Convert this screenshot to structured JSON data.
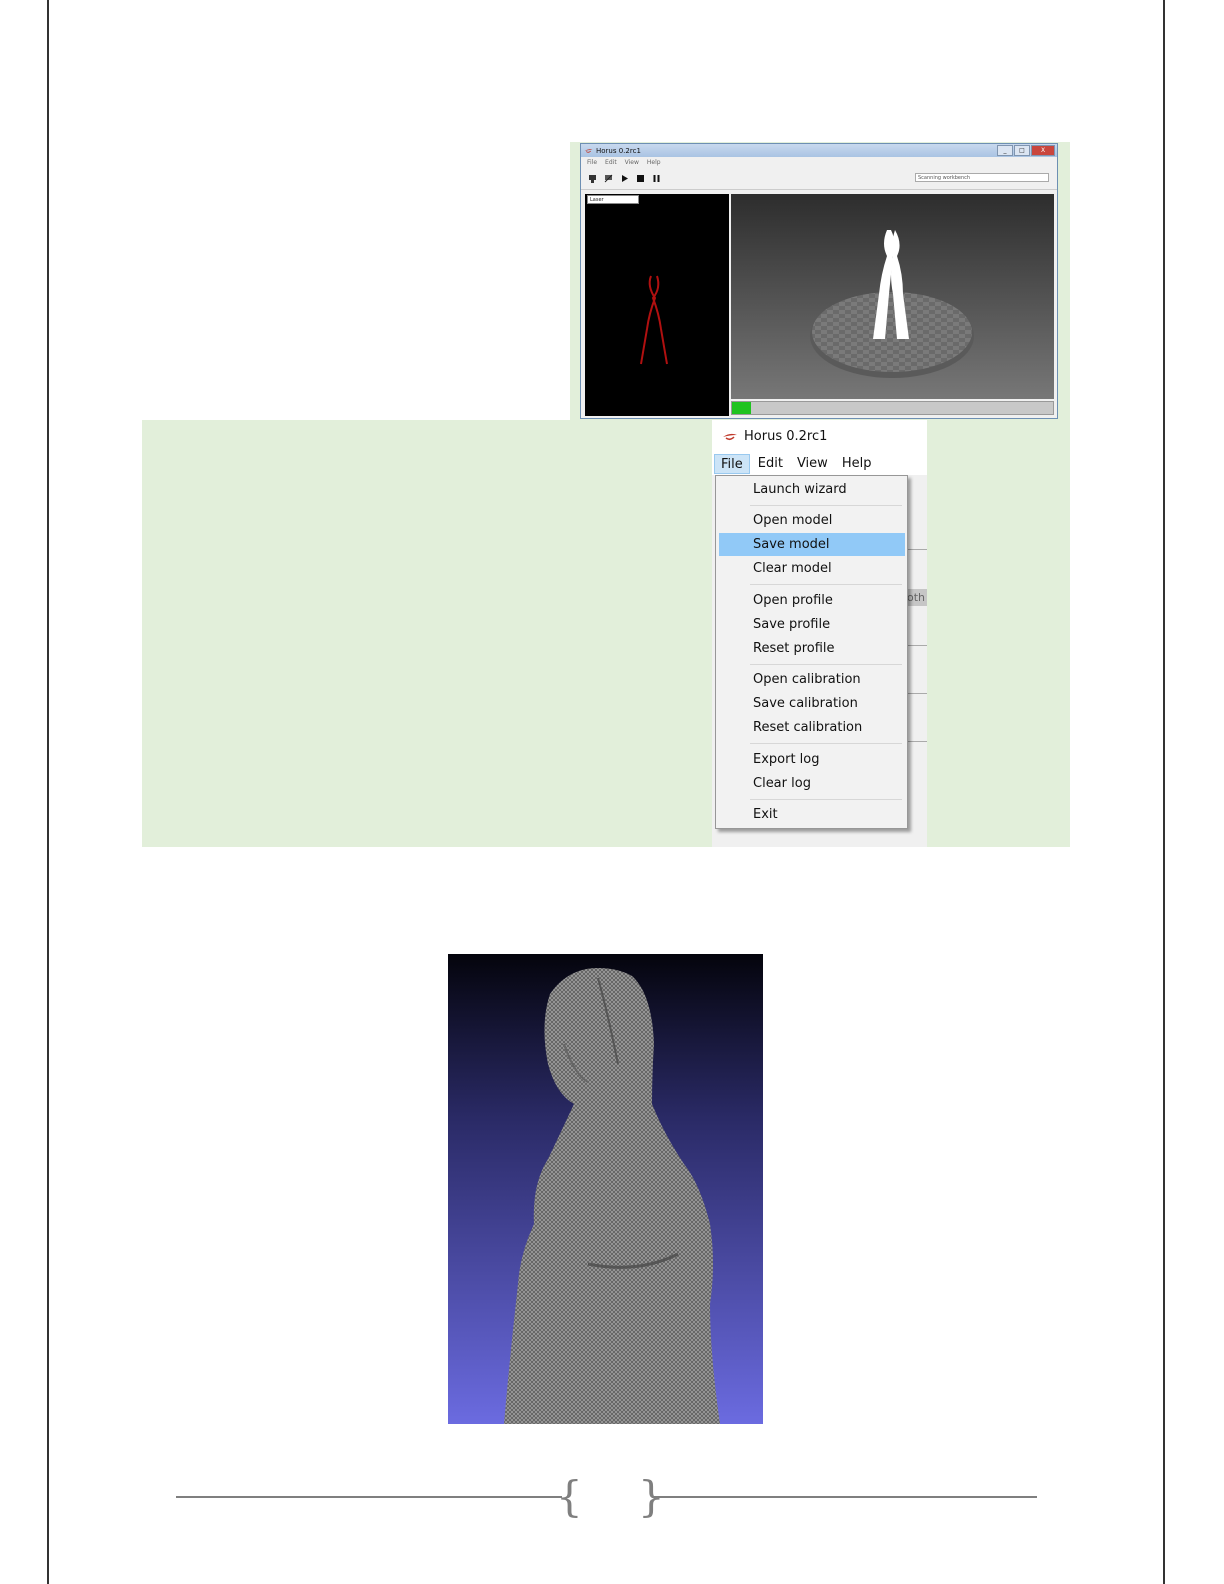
{
  "small_window": {
    "title": "Horus 0.2rc1",
    "menu": [
      "File",
      "Edit",
      "View",
      "Help"
    ],
    "toolbar_icons": [
      "connect-icon",
      "disconnect-icon",
      "play-icon",
      "stop-icon",
      "pause-icon"
    ],
    "workbench_select": "Scanning workbench",
    "camera_mode_select": "Laser",
    "controls": [
      "_",
      "□",
      "X"
    ]
  },
  "menu_window": {
    "title": "Horus 0.2rc1",
    "menubar": [
      "File",
      "Edit",
      "View",
      "Help"
    ],
    "active_menu": "File",
    "partial_text_behind": "oth",
    "file_menu": [
      {
        "label": "Launch wizard"
      },
      {
        "label": "Open model"
      },
      {
        "label": "Save model",
        "highlighted": true
      },
      {
        "label": "Clear model"
      },
      {
        "label": "Open profile"
      },
      {
        "label": "Save profile"
      },
      {
        "label": "Reset profile"
      },
      {
        "label": "Open calibration"
      },
      {
        "label": "Save calibration"
      },
      {
        "label": "Reset calibration"
      },
      {
        "label": "Export log"
      },
      {
        "label": "Clear log"
      },
      {
        "label": "Exit"
      }
    ]
  },
  "scan_progress": 0.06,
  "colors": {
    "panel_green": "#e2efda",
    "highlight": "#91c9f7",
    "progress": "#1fc31f",
    "mesh_bg_top": "#04040c",
    "mesh_bg_bottom": "#6b6be0"
  }
}
